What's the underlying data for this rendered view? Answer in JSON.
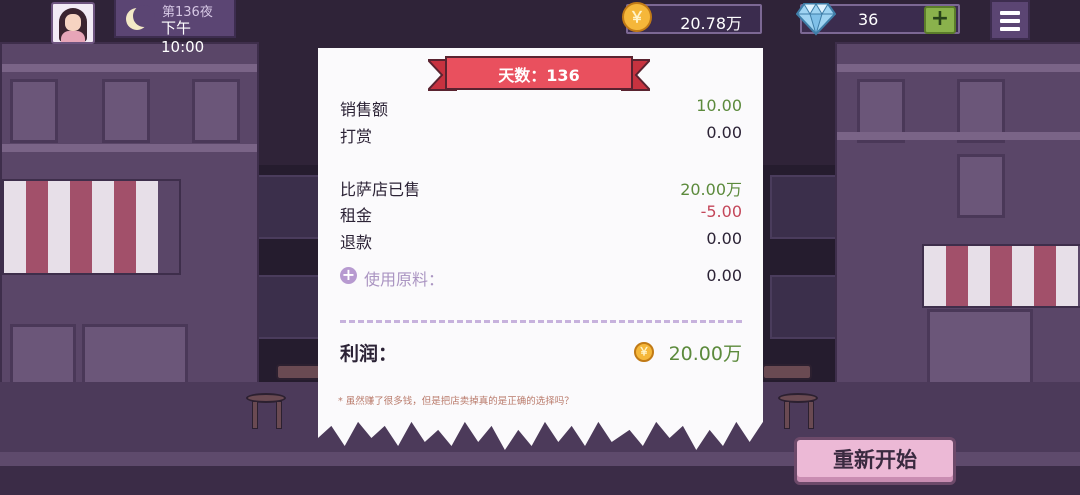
{
  "header": {
    "day_night": "第136夜",
    "time": "下午10:00",
    "coins": "20.78万",
    "gems": "36",
    "add_gems_label": "+"
  },
  "receipt": {
    "title": "天数：136",
    "rows": [
      {
        "label": "销售额",
        "value": "10.00"
      },
      {
        "label": "打赏",
        "value": "0.00"
      },
      {
        "label": "比萨店已售",
        "value": "20.00万"
      },
      {
        "label": "租金",
        "value": "-5.00"
      },
      {
        "label": "退款",
        "value": "0.00"
      },
      {
        "label": "使用原料：",
        "value": "0.00"
      }
    ],
    "profit_label": "利润：",
    "profit_value": "20.00万",
    "footnote": "* 虽然赚了很多钱，但是把店卖掉真的是正确的选择吗？"
  },
  "restart_label": "重新开始",
  "colors": {
    "positive": "#5c8a3c",
    "negative": "#c4475a",
    "ribbon": "#e9505e",
    "button": "#ecb9d6"
  }
}
